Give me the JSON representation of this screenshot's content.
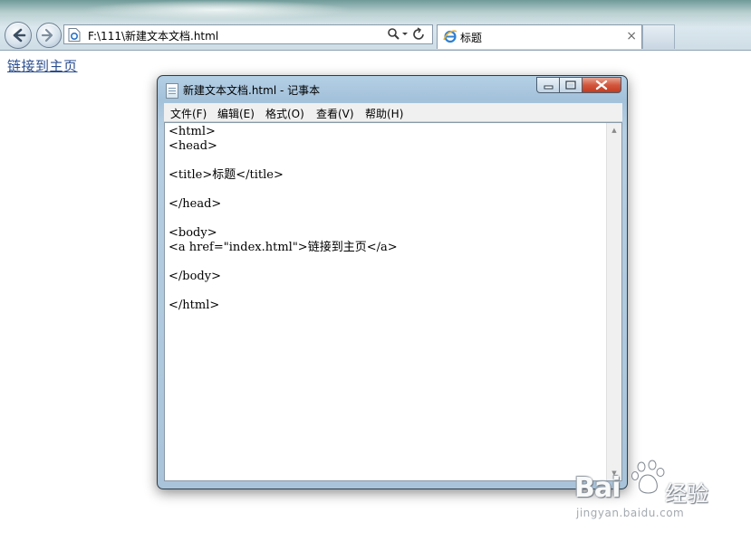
{
  "browser": {
    "address_url": "F:\\111\\新建文本文档.html",
    "tab_title": "标题",
    "tab_close_glyph": "×"
  },
  "page": {
    "link_text": "链接到主页"
  },
  "notepad": {
    "title": "新建文本文档.html - 记事本",
    "menu": [
      "文件(F)",
      "编辑(E)",
      "格式(O)",
      "查看(V)",
      "帮助(H)"
    ],
    "content": "<html>\n<head>\n\n<title>标题</title>\n\n</head>\n\n<body>\n<a href=\"index.html\">链接到主页</a>\n\n</body>\n\n</html>"
  },
  "watermark": {
    "brand": "Bai",
    "brand_tail": "经验",
    "domain": "jingyan.baidu.com"
  },
  "colors": {
    "link": "#2a4d8f",
    "close_button": "#c33b1f"
  }
}
